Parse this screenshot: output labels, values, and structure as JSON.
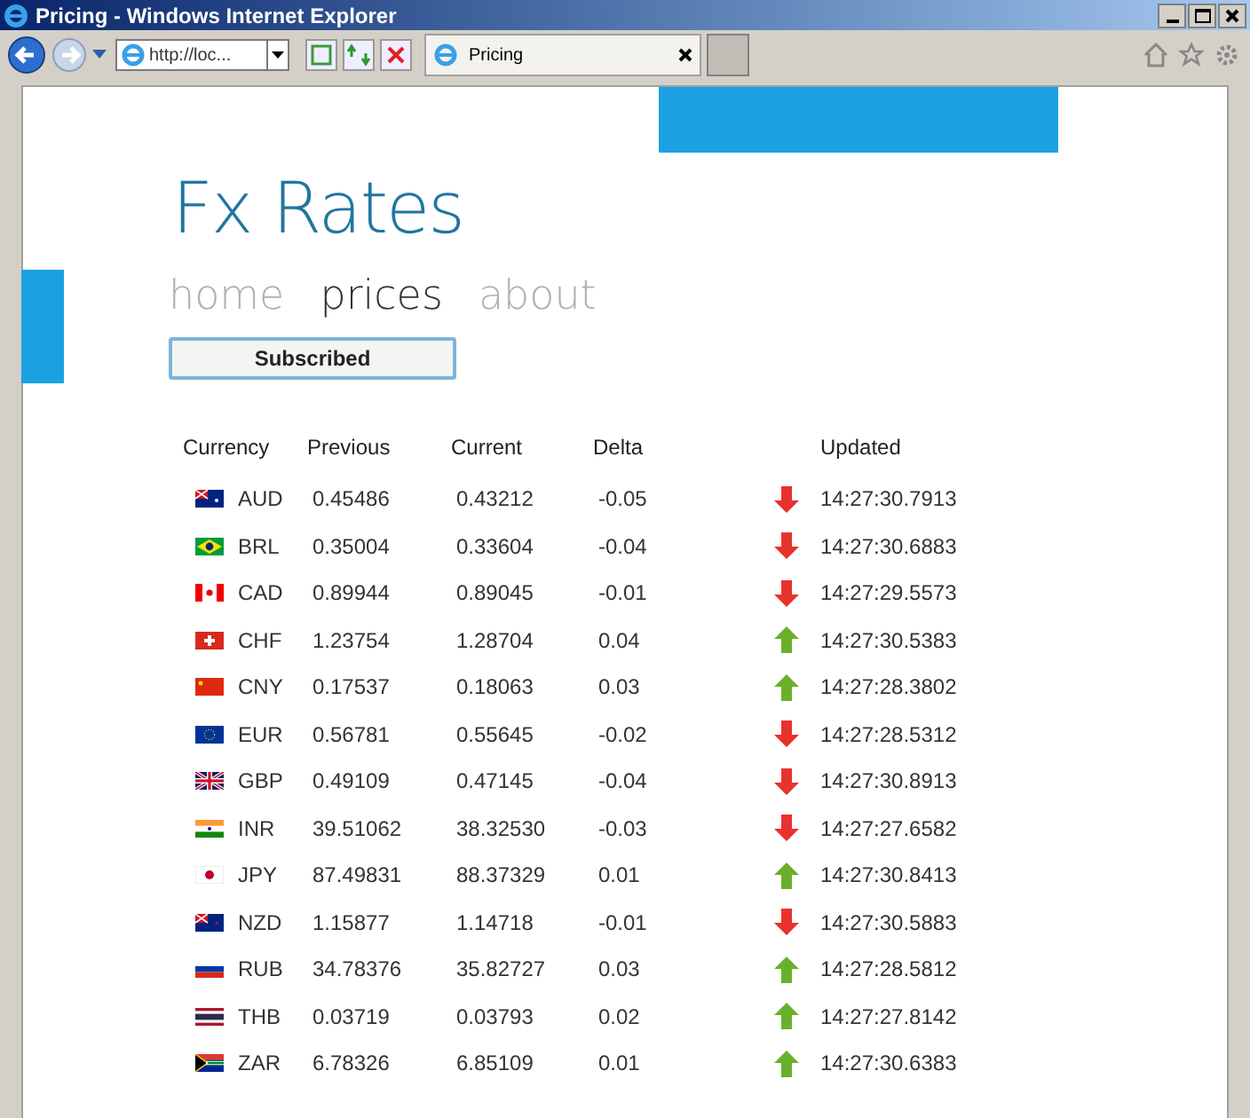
{
  "window": {
    "title": "Pricing - Windows Internet Explorer"
  },
  "browser": {
    "address": "http://loc...",
    "tabs": [
      {
        "label": "Pricing",
        "selected": true
      }
    ]
  },
  "page": {
    "title": "Fx Rates",
    "nav": [
      {
        "label": "home",
        "selected": false
      },
      {
        "label": "prices",
        "selected": true
      },
      {
        "label": "about",
        "selected": false
      }
    ],
    "subscribe_button": "Subscribed",
    "table": {
      "columns": [
        "Currency",
        "Previous",
        "Current",
        "Delta",
        "Updated"
      ],
      "rows": [
        {
          "currency": "AUD",
          "previous": "0.45486",
          "current": "0.43212",
          "delta": "-0.05",
          "kind": "down",
          "updated": "14:27:30.7913"
        },
        {
          "currency": "BRL",
          "previous": "0.35004",
          "current": "0.33604",
          "delta": "-0.04",
          "kind": "down",
          "updated": "14:27:30.6883"
        },
        {
          "currency": "CAD",
          "previous": "0.89944",
          "current": "0.89045",
          "delta": "-0.01",
          "kind": "down",
          "updated": "14:27:29.5573"
        },
        {
          "currency": "CHF",
          "previous": "1.23754",
          "current": "1.28704",
          "delta": "0.04",
          "kind": "up",
          "updated": "14:27:30.5383"
        },
        {
          "currency": "CNY",
          "previous": "0.17537",
          "current": "0.18063",
          "delta": "0.03",
          "kind": "up",
          "updated": "14:27:28.3802"
        },
        {
          "currency": "EUR",
          "previous": "0.56781",
          "current": "0.55645",
          "delta": "-0.02",
          "kind": "down",
          "updated": "14:27:28.5312"
        },
        {
          "currency": "GBP",
          "previous": "0.49109",
          "current": "0.47145",
          "delta": "-0.04",
          "kind": "down",
          "updated": "14:27:30.8913"
        },
        {
          "currency": "INR",
          "previous": "39.51062",
          "current": "38.32530",
          "delta": "-0.03",
          "kind": "down",
          "updated": "14:27:27.6582"
        },
        {
          "currency": "JPY",
          "previous": "87.49831",
          "current": "88.37329",
          "delta": "0.01",
          "kind": "up",
          "updated": "14:27:30.8413"
        },
        {
          "currency": "NZD",
          "previous": "1.15877",
          "current": "1.14718",
          "delta": "-0.01",
          "kind": "down",
          "updated": "14:27:30.5883"
        },
        {
          "currency": "RUB",
          "previous": "34.78376",
          "current": "35.82727",
          "delta": "0.03",
          "kind": "up",
          "updated": "14:27:28.5812"
        },
        {
          "currency": "THB",
          "previous": "0.03719",
          "current": "0.03793",
          "delta": "0.02",
          "kind": "up",
          "updated": "14:27:27.8142"
        },
        {
          "currency": "ZAR",
          "previous": "6.78326",
          "current": "6.85109",
          "delta": "0.01",
          "kind": "up",
          "updated": "14:27:30.6383"
        }
      ]
    }
  }
}
